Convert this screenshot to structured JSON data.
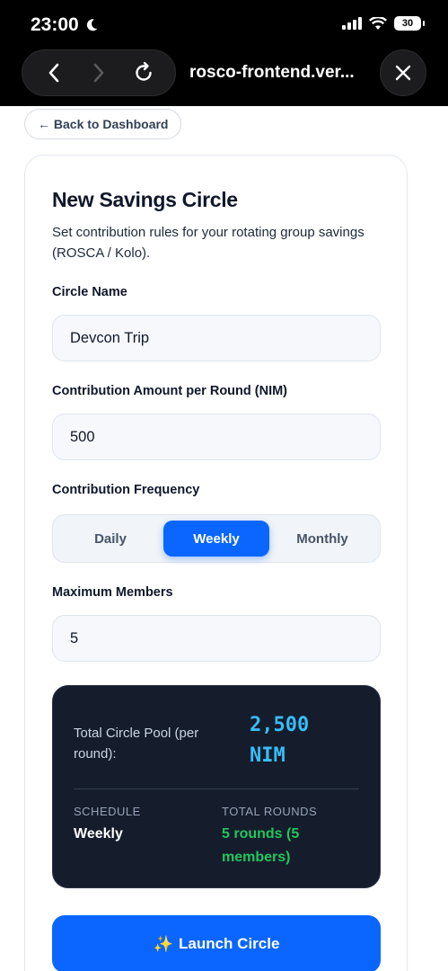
{
  "status_bar": {
    "time": "23:00",
    "battery": "30"
  },
  "browser": {
    "url": "rosco-frontend.ver..."
  },
  "page": {
    "back_label": "← Back to Dashboard",
    "title": "New Savings Circle",
    "subtitle": "Set contribution rules for your rotating group savings (ROSCA / Kolo).",
    "circle_name": {
      "label": "Circle Name",
      "value": "Devcon Trip"
    },
    "amount": {
      "label": "Contribution Amount per Round (NIM)",
      "value": "500"
    },
    "frequency": {
      "label": "Contribution Frequency",
      "options": [
        "Daily",
        "Weekly",
        "Monthly"
      ],
      "selected": "Weekly"
    },
    "members": {
      "label": "Maximum Members",
      "value": "5"
    },
    "summary": {
      "pool_label": "Total Circle Pool (per round):",
      "pool_value_line1": "2,500",
      "pool_value_line2": "NIM",
      "schedule_label": "SCHEDULE",
      "schedule_value": "Weekly",
      "rounds_label": "TOTAL ROUNDS",
      "rounds_value": "5 rounds (5 members)"
    },
    "launch_label": "Launch Circle"
  },
  "colors": {
    "accent": "#0a66ff",
    "pool": "#38bdf8",
    "rounds": "#22c55e",
    "panel": "#151d2c"
  },
  "icons": [
    "moon-icon",
    "signal-icon",
    "wifi-icon",
    "back-arrow-icon",
    "forward-arrow-icon",
    "reload-icon",
    "close-icon",
    "sparkle-icon"
  ]
}
